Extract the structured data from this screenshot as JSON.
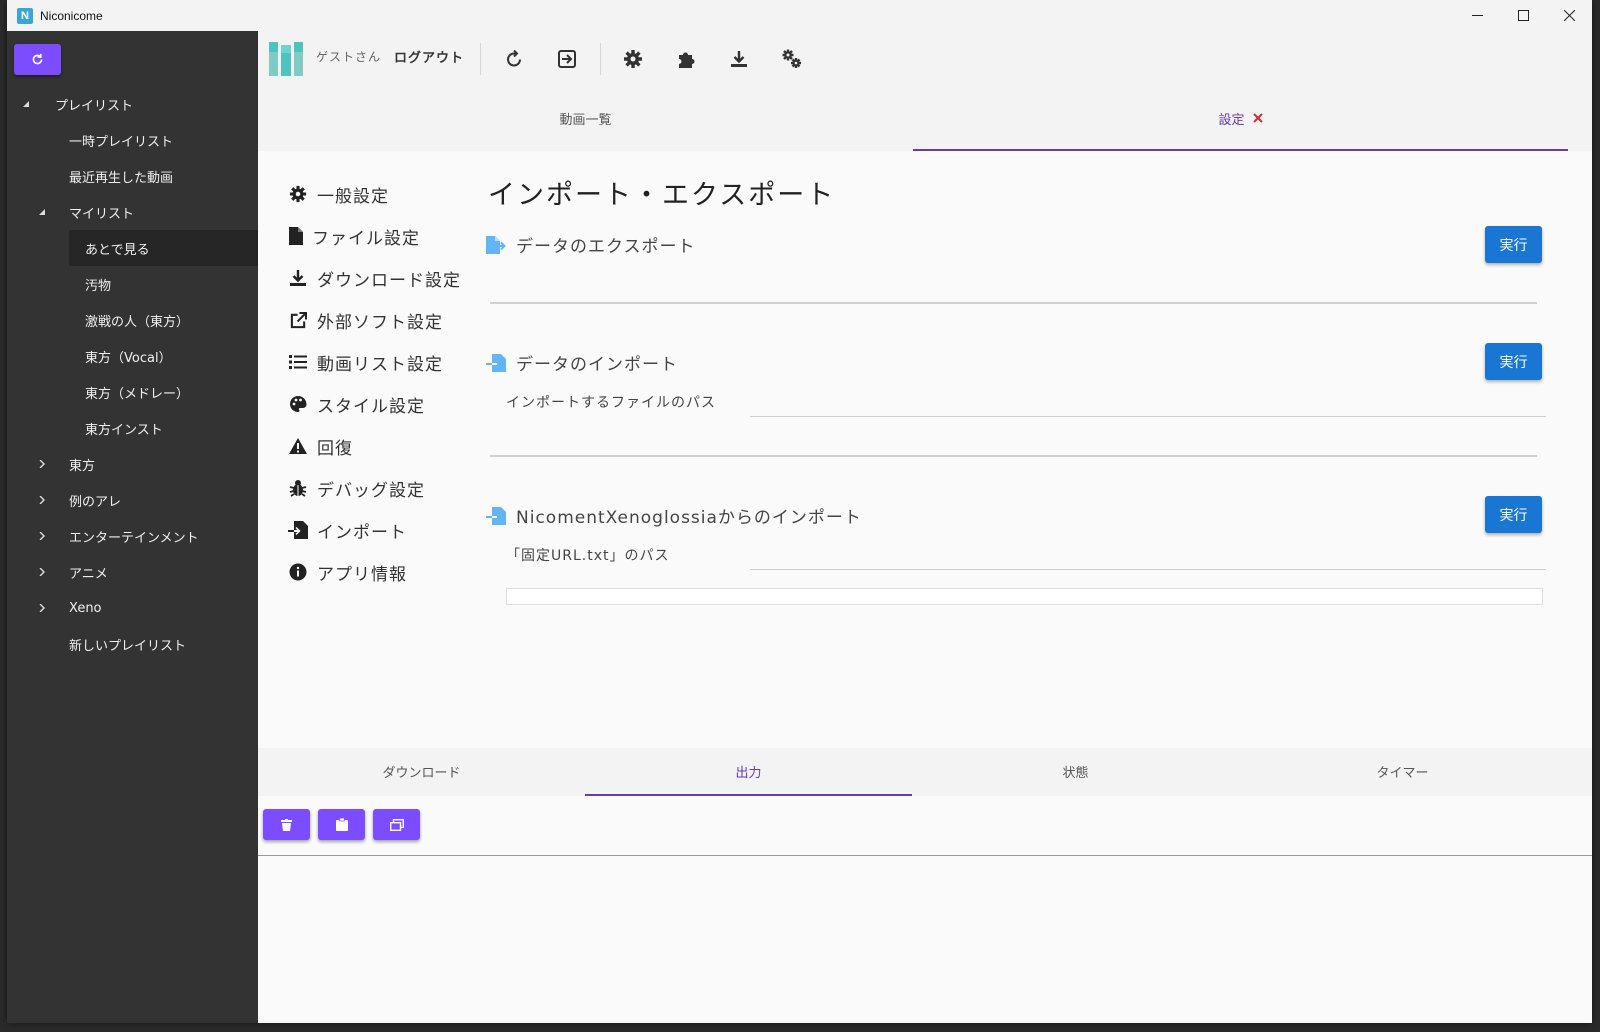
{
  "window": {
    "title": "Niconicome",
    "app_icon_letter": "N"
  },
  "colors": {
    "accent": "#7c4dff",
    "tab_active": "#673ab7",
    "run_button": "#1976d2",
    "sidebar_bg": "#333333",
    "close_x": "#d32f2f"
  },
  "toolbar": {
    "guest_label": "ゲストさん",
    "logout_label": "ログアウト",
    "icons": [
      "refresh-icon",
      "sign-in-icon",
      "gear-icon",
      "puzzle-icon",
      "download-icon",
      "gears-icon"
    ]
  },
  "sidebar": {
    "items": [
      {
        "label": "プレイリスト",
        "level": 0,
        "expanded": true
      },
      {
        "label": "一時プレイリスト",
        "level": 1
      },
      {
        "label": "最近再生した動画",
        "level": 1
      },
      {
        "label": "マイリスト",
        "level": 1,
        "expanded": true
      },
      {
        "label": "あとで見る",
        "level": 2,
        "selected": true
      },
      {
        "label": "汚物",
        "level": 2
      },
      {
        "label": "激戦の人（東方）",
        "level": 2
      },
      {
        "label": "東方（Vocal）",
        "level": 2
      },
      {
        "label": "東方（メドレー）",
        "level": 2
      },
      {
        "label": "東方インスト",
        "level": 2
      },
      {
        "label": "東方",
        "level": 1,
        "collapsed": true
      },
      {
        "label": "例のアレ",
        "level": 1,
        "collapsed": true
      },
      {
        "label": "エンターテインメント",
        "level": 1,
        "collapsed": true
      },
      {
        "label": "アニメ",
        "level": 1,
        "collapsed": true
      },
      {
        "label": "Xeno",
        "level": 1,
        "collapsed": true
      },
      {
        "label": "新しいプレイリスト",
        "level": 1
      }
    ]
  },
  "top_tabs": [
    {
      "label": "動画一覧",
      "active": false
    },
    {
      "label": "設定",
      "active": true,
      "closable": true
    }
  ],
  "settings_nav": [
    {
      "label": "一般設定",
      "icon": "gear-icon"
    },
    {
      "label": "ファイル設定",
      "icon": "file-icon"
    },
    {
      "label": "ダウンロード設定",
      "icon": "download-icon"
    },
    {
      "label": "外部ソフト設定",
      "icon": "external-link-icon"
    },
    {
      "label": "動画リスト設定",
      "icon": "list-icon"
    },
    {
      "label": "スタイル設定",
      "icon": "palette-icon"
    },
    {
      "label": "回復",
      "icon": "warning-icon"
    },
    {
      "label": "デバッグ設定",
      "icon": "bug-icon"
    },
    {
      "label": "インポート",
      "icon": "file-import-icon"
    },
    {
      "label": "アプリ情報",
      "icon": "info-icon"
    }
  ],
  "page": {
    "title": "インポート・エクスポート",
    "sections": [
      {
        "heading": "データのエクスポート",
        "icon": "file-export-icon",
        "button": "実行"
      },
      {
        "heading": "データのインポート",
        "icon": "file-import-icon",
        "button": "実行",
        "field_label": "インポートするファイルのパス",
        "field_value": ""
      },
      {
        "heading": "NicomentXenoglossiaからのインポート",
        "icon": "file-import-icon",
        "button": "実行",
        "field_label": "「固定URL.txt」のパス",
        "field_value": ""
      }
    ]
  },
  "bottom_tabs": [
    {
      "label": "ダウンロード",
      "active": false
    },
    {
      "label": "出力",
      "active": true
    },
    {
      "label": "状態",
      "active": false
    },
    {
      "label": "タイマー",
      "active": false
    }
  ],
  "output_buttons": [
    "trash-icon",
    "clipboard-icon",
    "window-restore-icon"
  ]
}
